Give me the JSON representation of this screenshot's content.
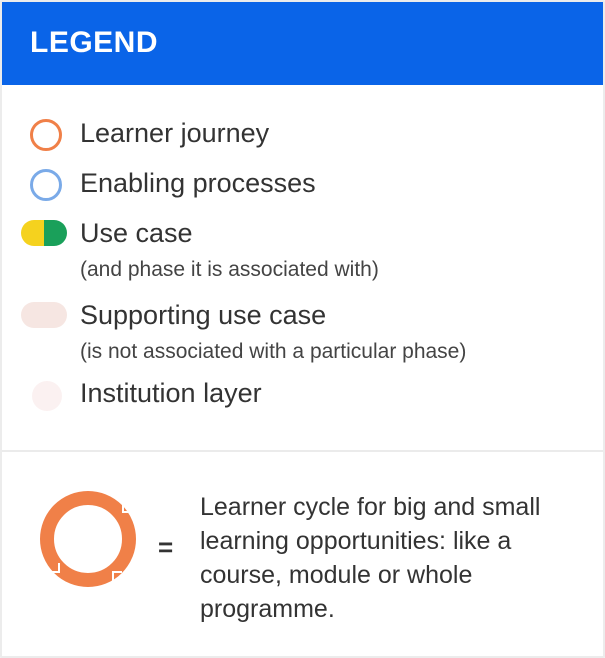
{
  "header": {
    "title": "LEGEND"
  },
  "legend": {
    "items": [
      {
        "label": "Learner journey",
        "icon": "orange-ring-icon",
        "color": "#f08048"
      },
      {
        "label": "Enabling processes",
        "icon": "blue-ring-icon",
        "color": "#7aaae8"
      },
      {
        "label": "Use case",
        "sublabel": "(and phase it is associated with)",
        "icon": "use-case-pill-icon",
        "colors": [
          "#f5d21e",
          "#1aa05a"
        ]
      },
      {
        "label": "Supporting use case",
        "sublabel": "(is not associated with a particular phase)",
        "icon": "supporting-use-case-pill-icon",
        "color": "#f6e6e2"
      },
      {
        "label": "Institution layer",
        "icon": "institution-layer-dot-icon",
        "color": "#fbf1f1"
      }
    ]
  },
  "cycle": {
    "equals": "=",
    "ring_color": "#f08048",
    "description_lines": [
      "Learner cycle for big and small",
      "learning opportunities: like a",
      "course, module or whole",
      "programme."
    ]
  }
}
